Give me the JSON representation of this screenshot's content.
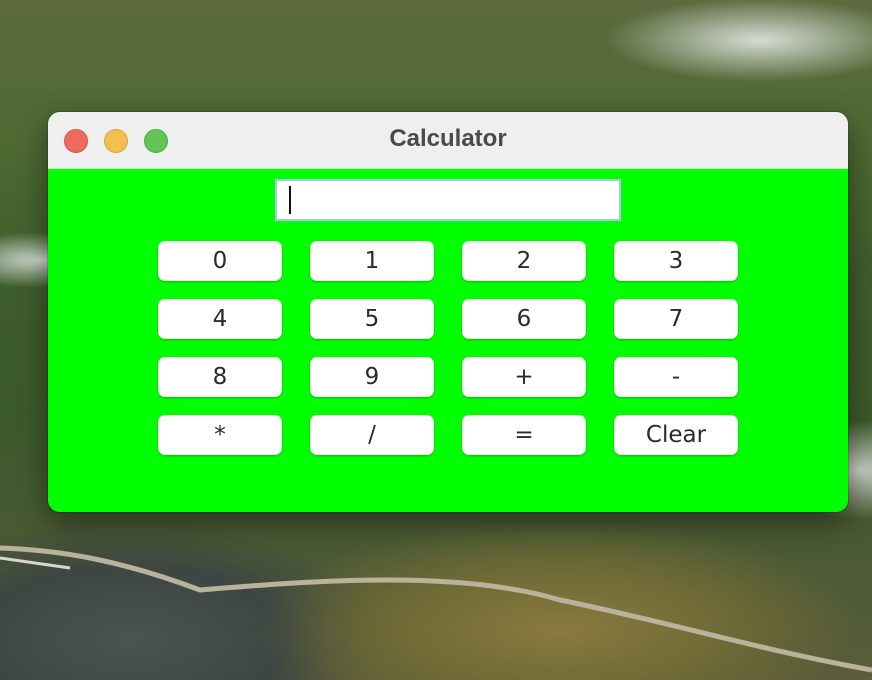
{
  "window": {
    "title": "Calculator",
    "background_color": "#00ff00",
    "titlebar_color": "#efefef"
  },
  "traffic_lights": {
    "close_color": "#ee6a5f",
    "minimize_color": "#f5bf4f",
    "maximize_color": "#61c554"
  },
  "display": {
    "value": "",
    "placeholder": ""
  },
  "keys": [
    {
      "label": "0",
      "name": "key-0-button"
    },
    {
      "label": "1",
      "name": "key-1-button"
    },
    {
      "label": "2",
      "name": "key-2-button"
    },
    {
      "label": "3",
      "name": "key-3-button"
    },
    {
      "label": "4",
      "name": "key-4-button"
    },
    {
      "label": "5",
      "name": "key-5-button"
    },
    {
      "label": "6",
      "name": "key-6-button"
    },
    {
      "label": "7",
      "name": "key-7-button"
    },
    {
      "label": "8",
      "name": "key-8-button"
    },
    {
      "label": "9",
      "name": "key-9-button"
    },
    {
      "label": "+",
      "name": "add-button"
    },
    {
      "label": "-",
      "name": "subtract-button"
    },
    {
      "label": "*",
      "name": "multiply-button"
    },
    {
      "label": "/",
      "name": "divide-button"
    },
    {
      "label": "=",
      "name": "equals-button"
    },
    {
      "label": "Clear",
      "name": "clear-button"
    }
  ]
}
